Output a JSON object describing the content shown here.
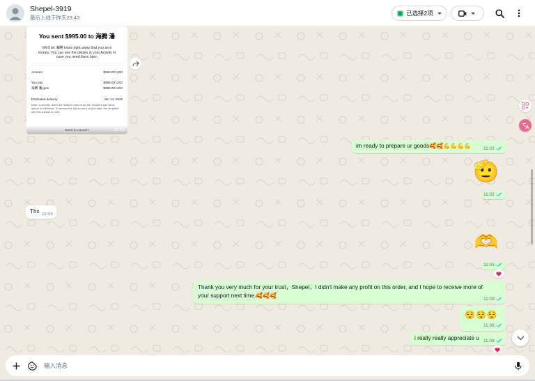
{
  "header": {
    "contact_name": "Shepel-3919",
    "last_seen": "最后上线于昨天23:43",
    "selected_label": "已选择2项",
    "icons": [
      "avatar-icon",
      "selection-icon",
      "video-call-icon",
      "search-icon",
      "menu-icon"
    ]
  },
  "receipt": {
    "title": "You sent $995.00 to 海腾 潘",
    "subtitle": "We'll let 海腾 know right away that you sent money. You can see the details in your Activity in case you need them later.",
    "amount_label": "Amount",
    "amount_value": "$995.00 USD",
    "you_pay_label": "You pay",
    "you_pay_value": "$995.00 USD",
    "recipient_label": "海腾 潘 gets",
    "recipient_value": "$995.00 USD",
    "delivery_label": "Estimated delivery",
    "delivery_value": "Jan 14, 2026",
    "note": "Note: Currently, there are limits to how much the recipient can send, spend or withdraw. To access the full amount on this date, the recipient can link a bank or card.",
    "cancel_text": "Need to cancel?",
    "time": "11:02"
  },
  "messages": [
    {
      "id": "m1",
      "direction": "out",
      "text": "im ready to prepare ur goods",
      "emoji": "🥰🥰💪💪💪💪",
      "time": "11:02",
      "status": "read"
    },
    {
      "id": "m2",
      "direction": "out",
      "emoji": "🫡",
      "time": "11:02",
      "status": "read"
    },
    {
      "id": "m3",
      "direction": "in",
      "text": "Thx",
      "time": "11:03"
    },
    {
      "id": "m4",
      "direction": "out",
      "emoji": "🫶",
      "time": "11:03",
      "status": "read",
      "reaction": "❤️"
    },
    {
      "id": "m5",
      "direction": "out",
      "text_line1": "Thank you very much for your trust，Shepel，I didn't make any profit on this order, and I hope to receive more of",
      "text_line2": "your support next time.",
      "emoji": "🥰🥰🥰",
      "time": "11:08",
      "status": "read"
    },
    {
      "id": "m6",
      "direction": "out",
      "emoji": "😌😌😌",
      "time": "11:08",
      "status": "read"
    },
    {
      "id": "m7",
      "direction": "out",
      "text": "i really really appreciate u",
      "time": "11:08",
      "status": "read",
      "reaction": "❤️"
    }
  ],
  "composer": {
    "placeholder": "输入消息",
    "icons": [
      "plus-icon",
      "sticker-icon",
      "microphone-icon"
    ]
  },
  "colors": {
    "chat_background": "#efeae2",
    "outgoing_bubble": "#d9fdd3",
    "incoming_bubble": "#ffffff",
    "read_ticks": "#53bdeb",
    "reaction_heart": "#e0245e",
    "side_button_accent": "#e86a92"
  }
}
